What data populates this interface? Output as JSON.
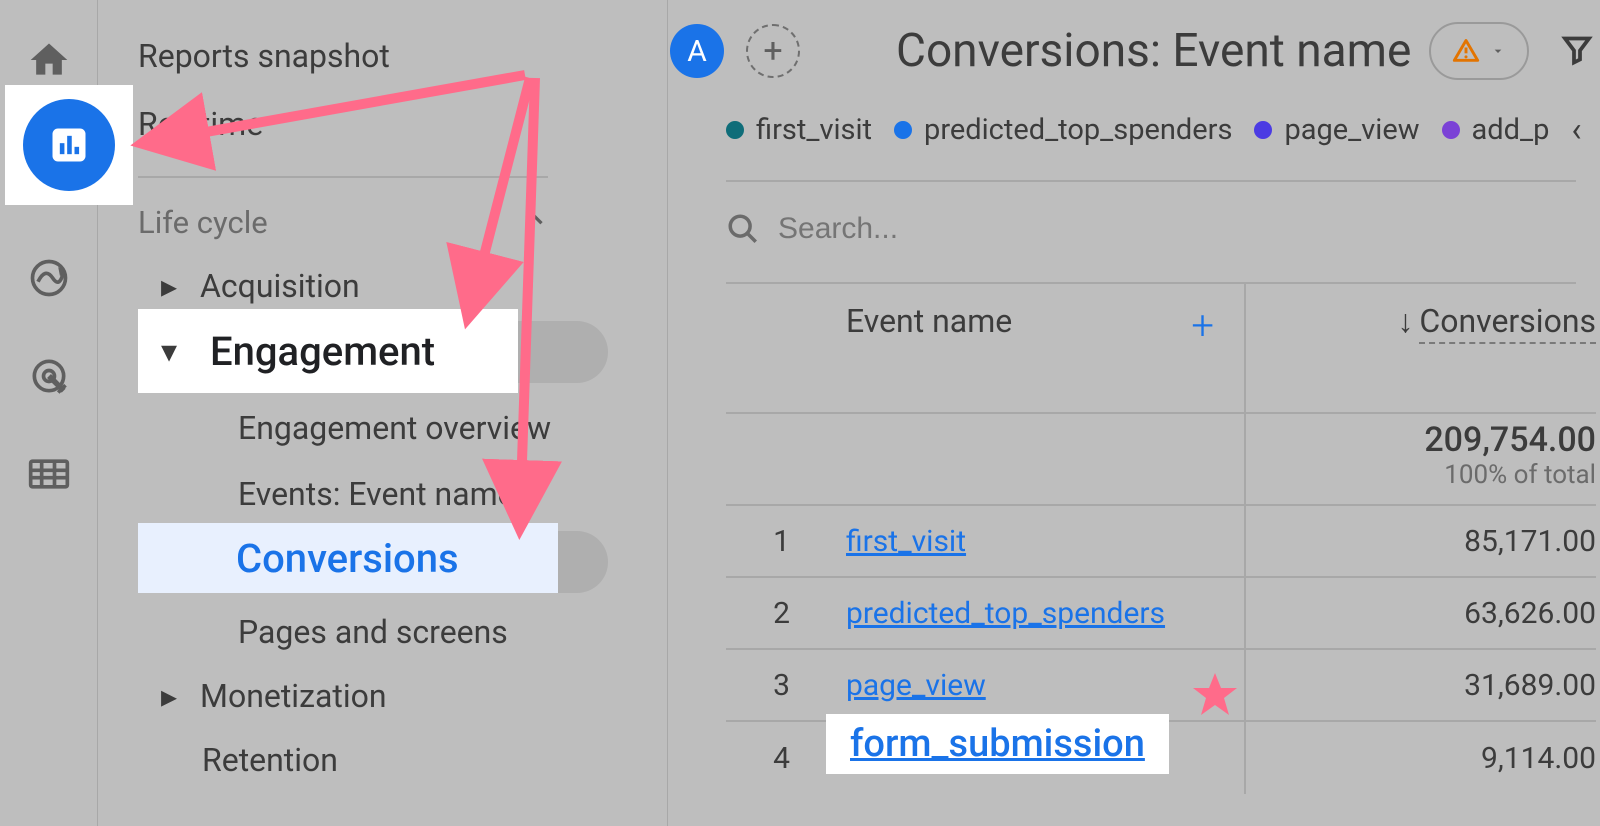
{
  "rail": {
    "home": "home-icon",
    "reports": "reports-icon",
    "explore": "explore-icon",
    "ads": "ads-icon",
    "library": "library-icon"
  },
  "sidebar": {
    "snapshot": "Reports snapshot",
    "realtime": "Realtime",
    "section_lifecycle": "Life cycle",
    "acquisition": "Acquisition",
    "engagement": "Engagement",
    "engagement_overview": "Engagement overview",
    "events": "Events: Event name",
    "conversions": "Conversions",
    "pages": "Pages and screens",
    "monetization": "Monetization",
    "retention": "Retention"
  },
  "header": {
    "segment_letter": "A",
    "title": "Conversions: Event name"
  },
  "legend": {
    "items": [
      {
        "label": "first_visit",
        "color": "#0f6d79"
      },
      {
        "label": "predicted_top_spenders",
        "color": "#1a73e8"
      },
      {
        "label": "page_view",
        "color": "#4b3be3"
      },
      {
        "label": "add_p",
        "color": "#7b42d6"
      }
    ]
  },
  "search": {
    "placeholder": "Search..."
  },
  "table": {
    "col_event": "Event name",
    "col_conversions": "Conversions",
    "total": "209,754.00",
    "total_sub": "100% of total",
    "rows": [
      {
        "idx": "1",
        "name": "first_visit",
        "val": "85,171.00"
      },
      {
        "idx": "2",
        "name": "predicted_top_spenders",
        "val": "63,626.00"
      },
      {
        "idx": "3",
        "name": "page_view",
        "val": "31,689.00"
      },
      {
        "idx": "4",
        "name": "form_submission",
        "val": "9,114.00"
      }
    ]
  }
}
